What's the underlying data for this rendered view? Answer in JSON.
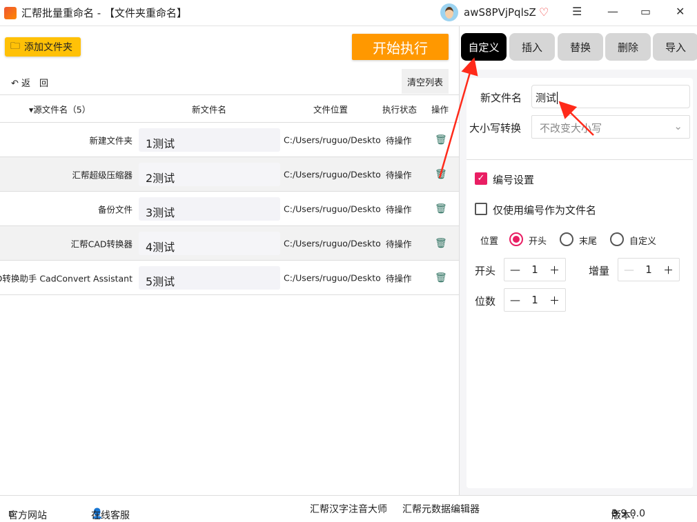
{
  "window": {
    "title": "汇帮批量重命名 - 【文件夹重命名】",
    "username": "awS8PVjPqlsZ"
  },
  "toolbar": {
    "add_folder": "添加文件夹",
    "start": "开始执行",
    "back": "返　回",
    "clear": "清空列表"
  },
  "table": {
    "headers": [
      "源文件名（5）",
      "新文件名",
      "文件位置",
      "执行状态",
      "操作"
    ],
    "rows": [
      {
        "source": "新建文件夹",
        "new": "1测试",
        "path": "C:/Users/ruguo/Deskto",
        "status": "待操作"
      },
      {
        "source": "汇帮超级压缩器",
        "new": "2测试",
        "path": "C:/Users/ruguo/Deskto",
        "status": "待操作"
      },
      {
        "source": "备份文件",
        "new": "3测试",
        "path": "C:/Users/ruguo/Deskto",
        "status": "待操作"
      },
      {
        "source": "汇帮CAD转换器",
        "new": "4测试",
        "path": "C:/Users/ruguo/Deskto",
        "status": "待操作"
      },
      {
        "source": "CAD转换助手 CadConvert Assistant",
        "new": "5测试",
        "path": "C:/Users/ruguo/Deskto",
        "status": "待操作"
      }
    ]
  },
  "tabs": [
    "自定义",
    "插入",
    "替换",
    "删除",
    "导入"
  ],
  "form": {
    "new_name_label": "新文件名",
    "new_name_value": "测试",
    "case_label": "大小写转换",
    "case_value": "不改变大小写",
    "numbering_label": "编号设置",
    "numbering_checked": true,
    "only_number_label": "仅使用编号作为文件名",
    "only_number_checked": false,
    "position_label": "位置",
    "positions": [
      "开头",
      "末尾",
      "自定义"
    ],
    "position_selected": "开头",
    "start_label": "开头",
    "start_value": "1",
    "increment_label": "增量",
    "increment_value": "1",
    "digits_label": "位数",
    "digits_value": "1"
  },
  "footer": {
    "website": "官方网站",
    "support": "在线客服",
    "app1": "汇帮汉字注音大师",
    "app2": "汇帮元数据编辑器",
    "version_label": "版本：",
    "version": "3.9.0.0"
  },
  "colors": {
    "accent": "#ff9800",
    "add": "#ffc107",
    "check": "#e91e63",
    "annotation": "#ff2a1a"
  }
}
